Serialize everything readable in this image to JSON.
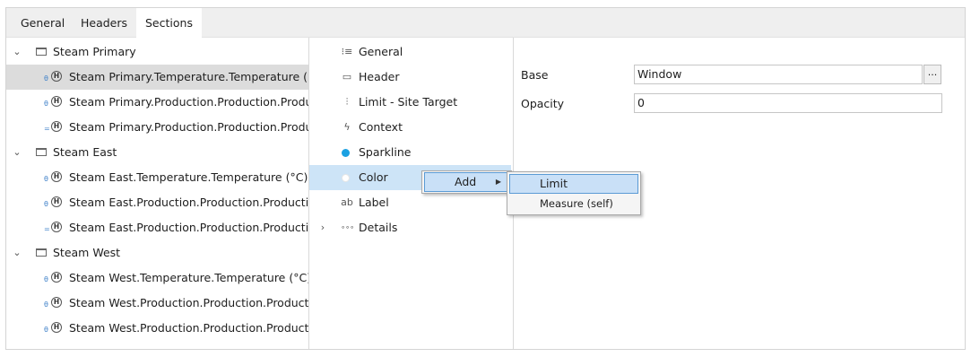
{
  "tabs": [
    {
      "label": "General",
      "active": false
    },
    {
      "label": "Headers",
      "active": false
    },
    {
      "label": "Sections",
      "active": true
    }
  ],
  "tree": {
    "groups": [
      {
        "label": "Steam Primary",
        "items": [
          {
            "badge": "θ",
            "label": "Steam Primary.Temperature.Temperature (°C)",
            "selected": true
          },
          {
            "badge": "θ",
            "label": "Steam Primary.Production.Production.Product"
          },
          {
            "badge": "=",
            "label": "Steam Primary.Production.Production.Product"
          }
        ]
      },
      {
        "label": "Steam East",
        "items": [
          {
            "badge": "θ",
            "label": "Steam East.Temperature.Temperature (°C)"
          },
          {
            "badge": "θ",
            "label": "Steam East.Production.Production.Production."
          },
          {
            "badge": "=",
            "label": "Steam East.Production.Production.Production."
          }
        ]
      },
      {
        "label": "Steam West",
        "items": [
          {
            "badge": "θ",
            "label": "Steam West.Temperature.Temperature (°C)"
          },
          {
            "badge": "θ",
            "label": "Steam West.Production.Production.Productior"
          },
          {
            "badge": "θ",
            "label": "Steam West.Production.Production.Productior"
          }
        ]
      }
    ]
  },
  "sections": [
    {
      "label": "General",
      "icon": "list-icon",
      "glyph": "⁝≡"
    },
    {
      "label": "Header",
      "icon": "header-icon",
      "glyph": "▭"
    },
    {
      "label": "Limit - Site Target",
      "icon": "limit-icon",
      "glyph": "⫶"
    },
    {
      "label": "Context",
      "icon": "lightning-icon",
      "glyph": "ϟ"
    },
    {
      "label": "Sparkline",
      "icon": "blue-dot-icon",
      "glyph": ""
    },
    {
      "label": "Color",
      "icon": "white-dot-icon",
      "glyph": "",
      "selected": true
    },
    {
      "label": "Label",
      "icon": "text-ab-icon",
      "glyph": "ab"
    },
    {
      "label": "Details",
      "icon": "dots-icon",
      "glyph": "∘∘∘",
      "expandable": true
    }
  ],
  "properties": {
    "base_label": "Base",
    "base_value": "Window",
    "browse_label": "...",
    "opacity_label": "Opacity",
    "opacity_value": "0"
  },
  "context_menu": {
    "add_label": "Add",
    "submenu": [
      "Limit",
      "Measure (self)"
    ]
  },
  "colors": {
    "sparkline_dot": "#1ba1e2",
    "selection_blue": "#cde4f7",
    "tree_selection": "#dcdcdc"
  }
}
